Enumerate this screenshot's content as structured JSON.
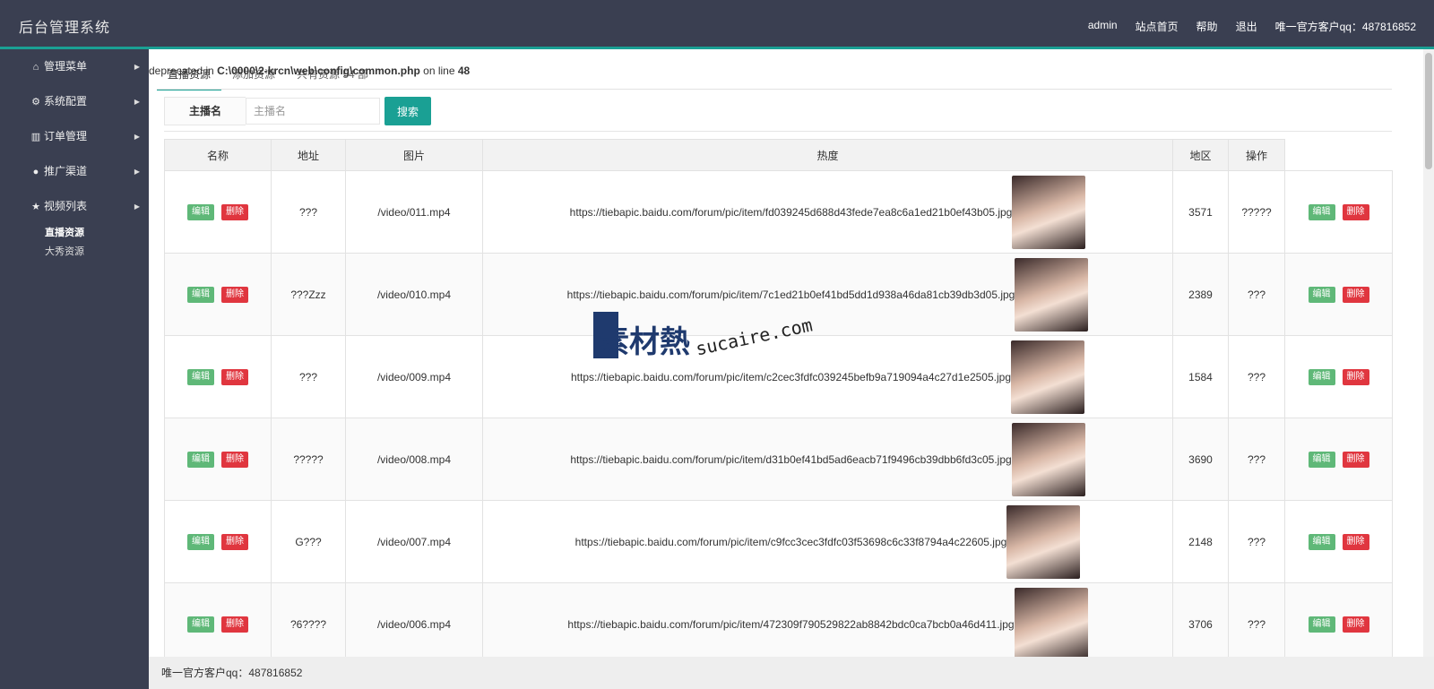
{
  "header": {
    "title": "后台管理系统",
    "nav": [
      "admin",
      "站点首页",
      "帮助",
      "退出",
      "唯一官方客户qq：487816852"
    ]
  },
  "sidebar": {
    "items": [
      {
        "icon": "home-icon",
        "label": "管理菜单"
      },
      {
        "icon": "gears-icon",
        "label": "系统配置"
      },
      {
        "icon": "bar-chart-icon",
        "label": "订单管理"
      },
      {
        "icon": "user-icon",
        "label": "推广渠道"
      },
      {
        "icon": "star-icon",
        "label": "视频列表"
      }
    ],
    "subitems": [
      "直播资源",
      "大秀资源"
    ]
  },
  "warning": {
    "prefix": "deprecated in",
    "file": "C:\\0000\\2-krcn\\web\\config\\common.php",
    "mid": "on line",
    "line": "48"
  },
  "tabs": [
    "直播资源",
    "添加资源",
    "共有资源 54 部"
  ],
  "search": {
    "label": "主播名",
    "placeholder": "主播名",
    "button": "搜索"
  },
  "table": {
    "headers": [
      "名称",
      "地址",
      "图片",
      "热度",
      "地区",
      "操作"
    ],
    "edit_label": "编辑",
    "delete_label": "删除",
    "rows": [
      {
        "name": "???",
        "address": "/video/011.mp4",
        "image": "https://tiebapic.baidu.com/forum/pic/item/fd039245d688d43fede7ea8c6a1ed21b0ef43b05.jpg",
        "heat": "3571",
        "region": "?????"
      },
      {
        "name": "???Zzz",
        "address": "/video/010.mp4",
        "image": "https://tiebapic.baidu.com/forum/pic/item/7c1ed21b0ef41bd5dd1d938a46da81cb39db3d05.jpg",
        "heat": "2389",
        "region": "???"
      },
      {
        "name": "???",
        "address": "/video/009.mp4",
        "image": "https://tiebapic.baidu.com/forum/pic/item/c2cec3fdfc039245befb9a719094a4c27d1e2505.jpg",
        "heat": "1584",
        "region": "???"
      },
      {
        "name": "?????",
        "address": "/video/008.mp4",
        "image": "https://tiebapic.baidu.com/forum/pic/item/d31b0ef41bd5ad6eacb71f9496cb39dbb6fd3c05.jpg",
        "heat": "3690",
        "region": "???"
      },
      {
        "name": "G???",
        "address": "/video/007.mp4",
        "image": "https://tiebapic.baidu.com/forum/pic/item/c9fcc3cec3fdfc03f53698c6c33f8794a4c22605.jpg",
        "heat": "2148",
        "region": "???"
      },
      {
        "name": "?6????",
        "address": "/video/006.mp4",
        "image": "https://tiebapic.baidu.com/forum/pic/item/472309f790529822ab8842bdc0ca7bcb0a46d411.jpg",
        "heat": "3706",
        "region": "???"
      }
    ]
  },
  "footer": {
    "text": "唯一官方客户qq：487816852"
  },
  "watermark": {
    "cn": "素材熱",
    "domain": "sucaire.com"
  },
  "colors": {
    "topbar": "#3a3f51",
    "accent": "#1aa094",
    "edit": "#5fb878",
    "delete": "#e0363f"
  }
}
